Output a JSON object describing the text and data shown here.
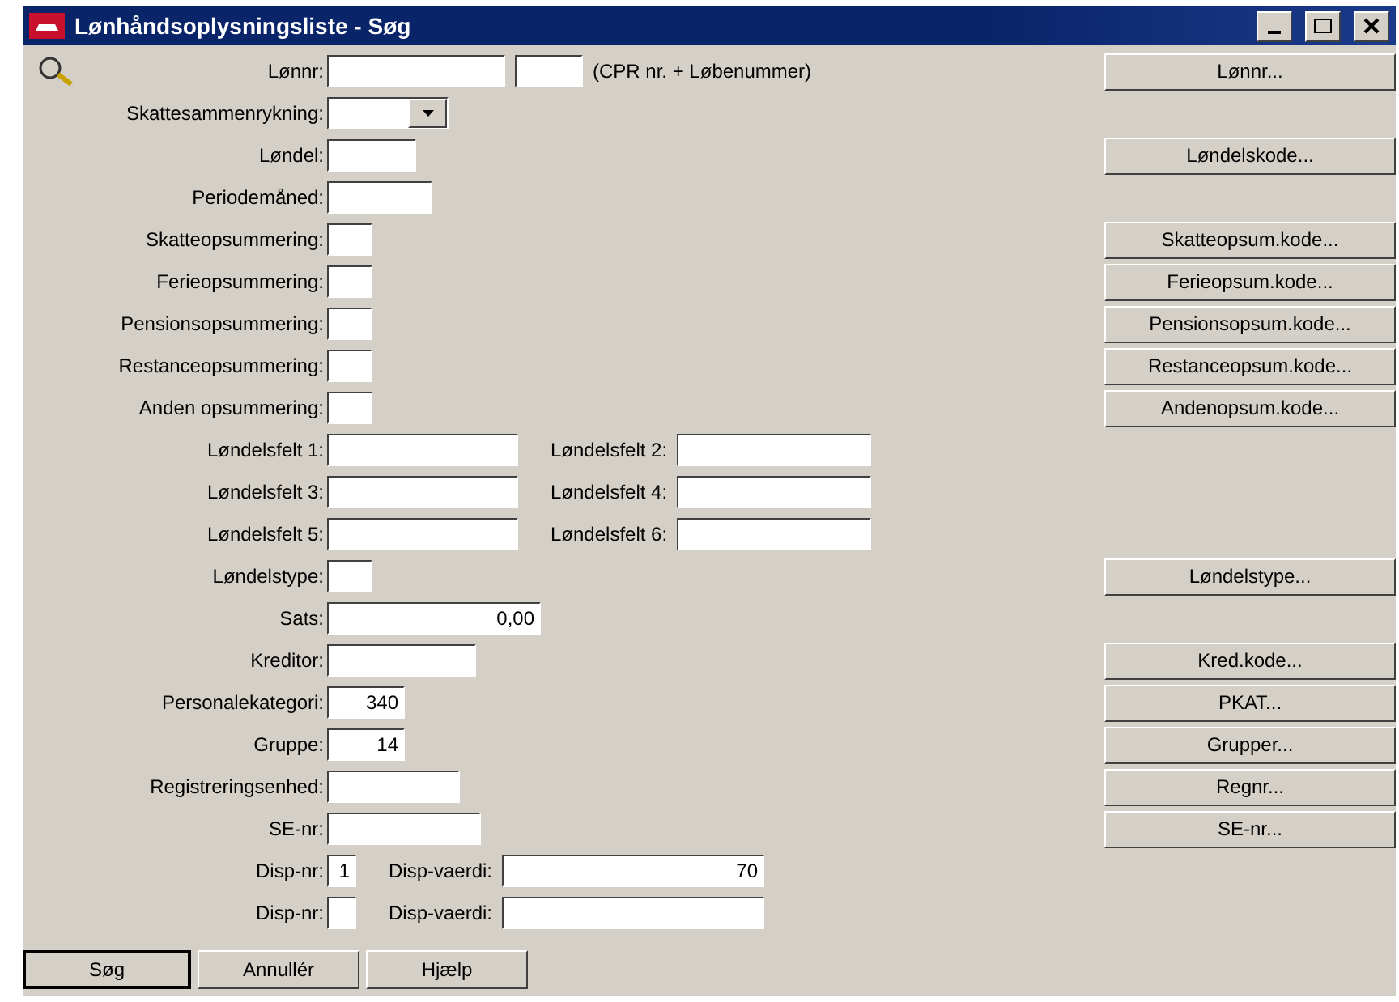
{
  "window": {
    "title": "Lønhåndsoplysningsliste - Søg"
  },
  "rows": [
    {
      "label": "Lønnr:",
      "items": [
        {
          "kind": "field",
          "value": ""
        },
        {
          "kind": "field",
          "value": ""
        },
        {
          "kind": "note",
          "text": "(CPR nr. + Løbenummer)"
        }
      ],
      "button": "Lønnr..."
    },
    {
      "label": "Skattesammenrykning:",
      "items": [
        {
          "kind": "combo",
          "value": ""
        }
      ]
    },
    {
      "label": "Løndel:",
      "items": [
        {
          "kind": "field",
          "value": ""
        }
      ],
      "button": "Løndelskode..."
    },
    {
      "label": "Periodemåned:",
      "items": [
        {
          "kind": "field",
          "value": ""
        }
      ]
    },
    {
      "label": "Skatteopsummering:",
      "items": [
        {
          "kind": "field",
          "value": ""
        }
      ],
      "button": "Skatteopsum.kode..."
    },
    {
      "label": "Ferieopsummering:",
      "items": [
        {
          "kind": "field",
          "value": ""
        }
      ],
      "button": "Ferieopsum.kode..."
    },
    {
      "label": "Pensionsopsummering:",
      "items": [
        {
          "kind": "field",
          "value": ""
        }
      ],
      "button": "Pensionsopsum.kode..."
    },
    {
      "label": "Restanceopsummering:",
      "items": [
        {
          "kind": "field",
          "value": ""
        }
      ],
      "button": "Restanceopsum.kode..."
    },
    {
      "label": "Anden opsummering:",
      "items": [
        {
          "kind": "field",
          "value": ""
        }
      ],
      "button": "Andenopsum.kode..."
    },
    {
      "label": "Løndelsfelt 1:",
      "items": [
        {
          "kind": "field",
          "value": ""
        },
        {
          "kind": "label",
          "text": "Løndelsfelt 2:"
        },
        {
          "kind": "field",
          "value": ""
        }
      ]
    },
    {
      "label": "Løndelsfelt 3:",
      "items": [
        {
          "kind": "field",
          "value": ""
        },
        {
          "kind": "label",
          "text": "Løndelsfelt 4:"
        },
        {
          "kind": "field",
          "value": ""
        }
      ]
    },
    {
      "label": "Løndelsfelt 5:",
      "items": [
        {
          "kind": "field",
          "value": ""
        },
        {
          "kind": "label",
          "text": "Løndelsfelt 6:"
        },
        {
          "kind": "field",
          "value": ""
        }
      ]
    },
    {
      "label": "Løndelstype:",
      "items": [
        {
          "kind": "field",
          "value": ""
        }
      ],
      "button": "Løndelstype..."
    },
    {
      "label": "Sats:",
      "items": [
        {
          "kind": "field",
          "value": "0,00"
        }
      ]
    },
    {
      "label": "Kreditor:",
      "items": [
        {
          "kind": "field",
          "value": ""
        }
      ],
      "button": "Kred.kode..."
    },
    {
      "label": "Personalekategori:",
      "items": [
        {
          "kind": "field",
          "value": "340"
        }
      ],
      "button": "PKAT..."
    },
    {
      "label": "Gruppe:",
      "items": [
        {
          "kind": "field",
          "value": "14"
        }
      ],
      "button": "Grupper..."
    },
    {
      "label": "Registreringsenhed:",
      "items": [
        {
          "kind": "field",
          "value": ""
        }
      ],
      "button": "Regnr..."
    },
    {
      "label": "SE-nr:",
      "items": [
        {
          "kind": "field",
          "value": ""
        }
      ],
      "button": "SE-nr..."
    },
    {
      "label": "Disp-nr:",
      "items": [
        {
          "kind": "field",
          "value": "1"
        },
        {
          "kind": "label",
          "text": "Disp-vaerdi:"
        },
        {
          "kind": "field",
          "value": "70"
        }
      ]
    },
    {
      "label": "Disp-nr:",
      "items": [
        {
          "kind": "field",
          "value": ""
        },
        {
          "kind": "label",
          "text": "Disp-vaerdi:"
        },
        {
          "kind": "field",
          "value": ""
        }
      ]
    }
  ],
  "footer_buttons": [
    "Søg",
    "Annullér",
    "Hjælp"
  ]
}
